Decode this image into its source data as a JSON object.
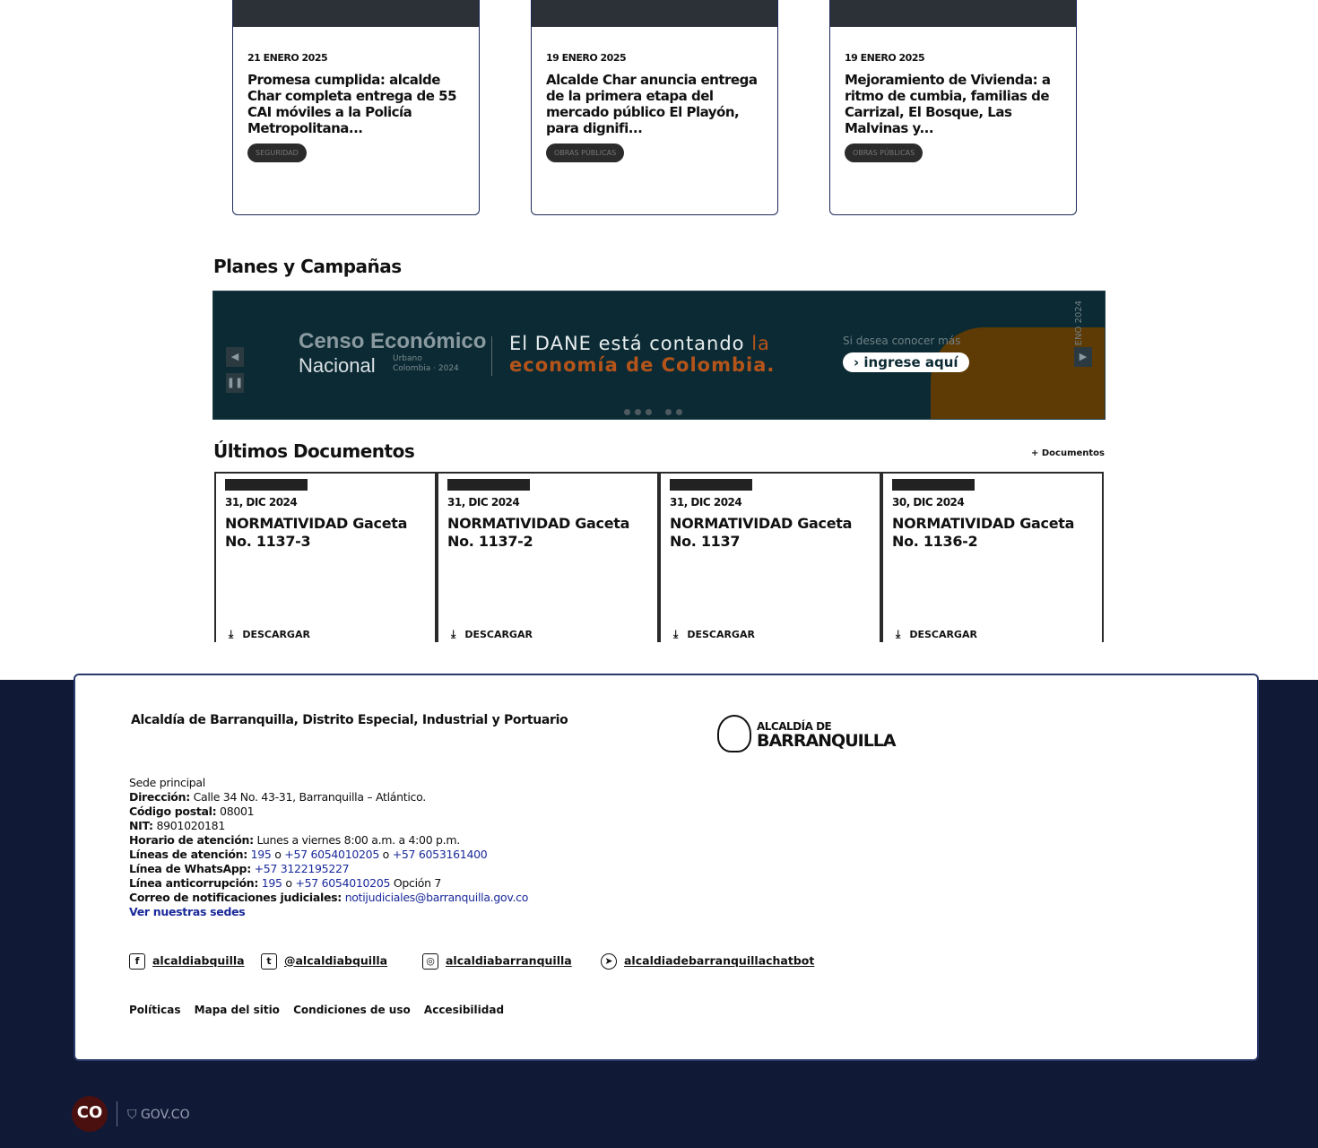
{
  "news": [
    {
      "date": "21 ENERO 2025",
      "title": "Promesa cumplida: alcalde Char completa entrega de 55 CAI móviles a la Policía Metropolitana...",
      "tag": "SEGURIDAD"
    },
    {
      "date": "19 ENERO 2025",
      "title": "Alcalde Char anuncia entrega de la primera etapa del mercado público El Playón, para dignifi...",
      "tag": "OBRAS PÚBLICAS"
    },
    {
      "date": "19 ENERO 2025",
      "title": "Mejoramiento de Vivienda: a ritmo de cumbia, familias de Carrizal, El Bosque, Las Malvinas y...",
      "tag": "OBRAS PÚBLICAS"
    }
  ],
  "planes": {
    "title": "Planes y Campañas",
    "banner": {
      "censo": "Censo Económico",
      "nacional": "Nacional",
      "urbano": "Urbano",
      "colombia": "Colombia · 2024",
      "dane_line1": "El DANE está contando",
      "dane_highlight": "la",
      "dane_line2": "economía de Colombia.",
      "conocer": "Si desea conocer más",
      "ingrese": "› ingrese aquí",
      "vertical": "ENO 2024",
      "prev": "◀",
      "next": "▶",
      "pause": "❚❚"
    }
  },
  "documentos": {
    "title": "Últimos Documentos",
    "more_link": "+ Documentos",
    "download_label": "DESCARGAR",
    "items": [
      {
        "date": "31, DIC 2024",
        "title": "NORMATIVIDAD Gaceta No. 1137-3"
      },
      {
        "date": "31, DIC 2024",
        "title": "NORMATIVIDAD Gaceta No. 1137-2"
      },
      {
        "date": "31, DIC 2024",
        "title": "NORMATIVIDAD Gaceta No. 1137"
      },
      {
        "date": "30, DIC 2024",
        "title": "NORMATIVIDAD Gaceta No. 1136-2"
      }
    ]
  },
  "footer": {
    "title": "Alcaldía de Barranquilla, Distrito Especial, Industrial y Portuario",
    "logo_line1": "ALCALDÍA DE",
    "logo_line2": "BARRANQUILLA",
    "sede": "Sede principal",
    "direccion_label": "Dirección:",
    "direccion": "Calle 34 No. 43-31, Barranquilla – Atlántico.",
    "postal_label": "Código postal:",
    "postal": "08001",
    "nit_label": "NIT:",
    "nit": "8901020181",
    "horario_label": "Horario de atención:",
    "horario": "Lunes a viernes 8:00 a.m. a 4:00 p.m.",
    "lineas_label": "Líneas de atención:",
    "lineas_1": "195",
    "lineas_o1": "o",
    "lineas_2": "+57 6054010205",
    "lineas_o2": "o",
    "lineas_3": "+57 6053161400",
    "whatsapp_label": "Línea de WhatsApp:",
    "whatsapp": "+57 3122195227",
    "anticorrupcion_label": "Línea anticorrupción:",
    "anti_1": "195",
    "anti_o": "o",
    "anti_2": "+57 6054010205",
    "anti_opcion": "Opción 7",
    "correo_label": "Correo de notificaciones judiciales:",
    "correo": "notijudiciales@barranquilla.gov.co",
    "sedes_link": "Ver nuestras sedes",
    "social": [
      {
        "icon": "facebook-icon",
        "glyph": "f",
        "label": "alcaldiabquilla"
      },
      {
        "icon": "twitter-icon",
        "glyph": "t",
        "label": "@alcaldiabquilla"
      },
      {
        "icon": "instagram-icon",
        "glyph": "◎",
        "label": "alcaldiabarranquilla"
      },
      {
        "icon": "telegram-icon",
        "glyph": "➤",
        "label": "alcaldiadebarranquillachatbot"
      }
    ],
    "links": [
      "Políticas",
      "Mapa del sitio",
      "Condiciones de uso",
      "Accesibilidad"
    ]
  },
  "govco": {
    "badge": "CO",
    "label": "GOV.CO",
    "shield": "⛉"
  },
  "colors": {
    "footer_bg": "#101935",
    "banner_bg": "#0c2a33",
    "accent_orange": "#b4541a",
    "link_blue": "#1a2a9a"
  }
}
